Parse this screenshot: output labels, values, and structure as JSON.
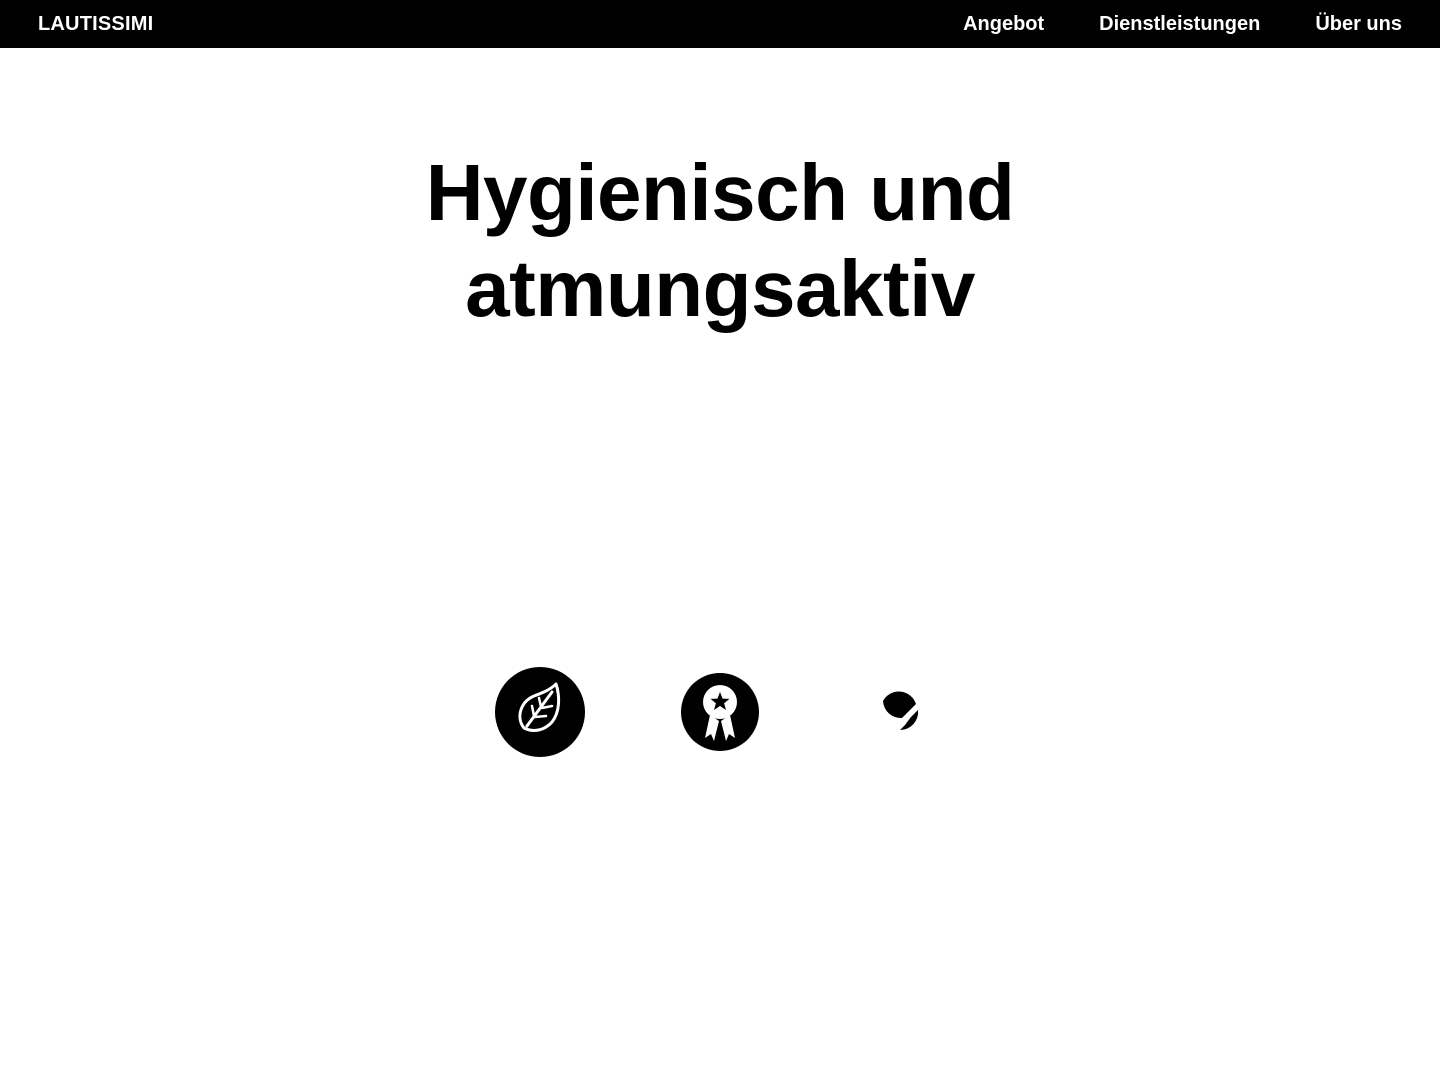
{
  "header": {
    "brand": "LAUTISSIMI",
    "nav": [
      {
        "label": "Angebot"
      },
      {
        "label": "Dienstleistungen"
      },
      {
        "label": "Über uns"
      }
    ]
  },
  "hero": {
    "title_line_1": "Hygienisch und",
    "title_line_2": "atmungsaktiv"
  },
  "features": {
    "icons": [
      "leaf-icon",
      "award-ribbon-icon",
      "partial-circle-icon"
    ]
  },
  "colors": {
    "background": "#ffffff",
    "header_background": "#000000",
    "text": "#000000",
    "header_text": "#ffffff"
  }
}
